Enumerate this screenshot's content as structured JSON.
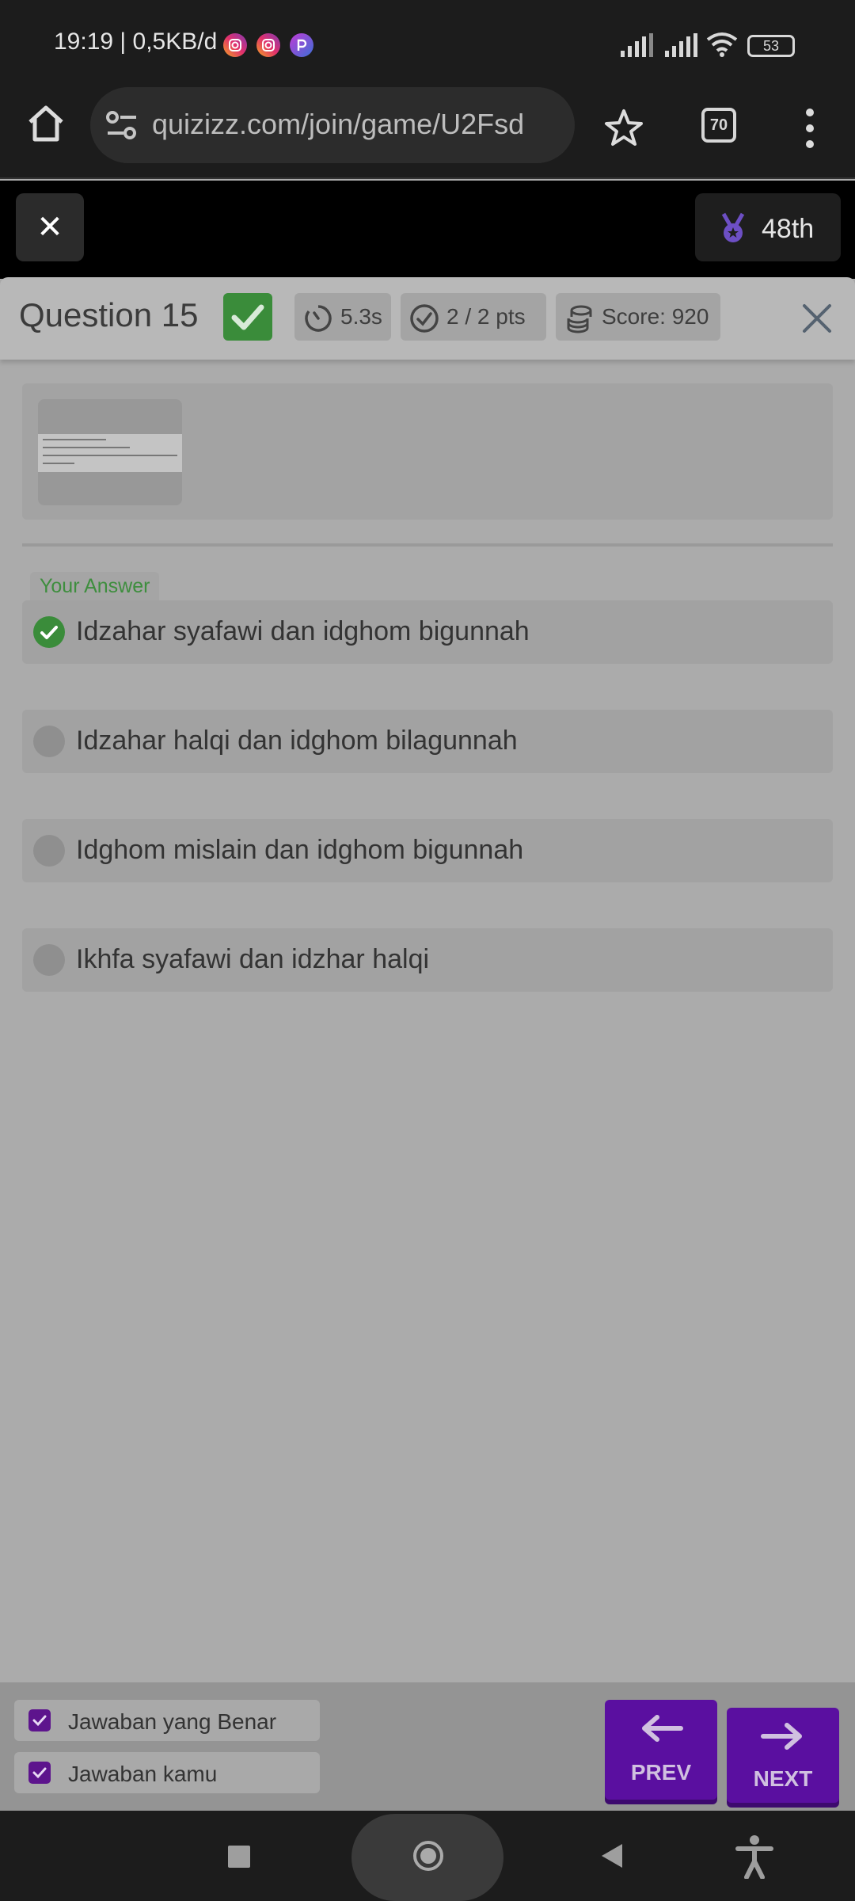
{
  "status_bar": {
    "time_speed": "19:19 | 0,5KB/d",
    "battery": "53",
    "app_icons": [
      "instagram-icon",
      "instagram-icon",
      "picsart-icon"
    ]
  },
  "browser": {
    "url": "quizizz.com/join/game/U2Fsd",
    "tab_count": "70"
  },
  "game": {
    "exit_label": "✕",
    "rank": "48th"
  },
  "question": {
    "title": "Question 15",
    "time": "5.3s",
    "points": "2 / 2 pts",
    "score": "Score: 920"
  },
  "answers": {
    "your_answer_label": "Your Answer",
    "options": [
      {
        "text": "Idzahar syafawi dan idghom bigunnah",
        "status": "correct"
      },
      {
        "text": "Idzahar halqi dan idghom bilagunnah",
        "status": "none"
      },
      {
        "text": "Idghom mislain dan idghom bigunnah",
        "status": "none"
      },
      {
        "text": "Ikhfa syafawi dan idzhar halqi",
        "status": "none"
      }
    ]
  },
  "footer": {
    "legend_correct": "Jawaban yang Benar",
    "legend_yours": "Jawaban kamu",
    "prev_label": "PREV",
    "next_label": "NEXT"
  },
  "colors": {
    "correct_green": "#3a8c3a",
    "accent_purple": "#5a0fa0"
  }
}
